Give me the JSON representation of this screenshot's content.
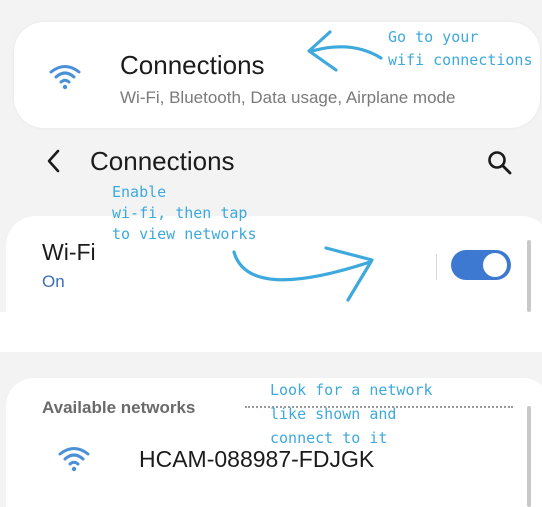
{
  "connections_card": {
    "title": "Connections",
    "subtitle": "Wi-Fi, Bluetooth, Data usage, Airplane mode",
    "icon": "wifi-icon"
  },
  "header": {
    "back_icon": "back-chevron-icon",
    "title": "Connections",
    "search_icon": "search-icon"
  },
  "wifi_row": {
    "label": "Wi-Fi",
    "state": "On",
    "toggle_on": true
  },
  "networks": {
    "section_label": "Available networks",
    "items": [
      {
        "name": "HCAM-088987-FDJGK",
        "icon": "wifi-icon"
      }
    ]
  },
  "annotations": {
    "note_1": [
      "Go to your",
      "wifi connections"
    ],
    "note_2": [
      "Enable",
      "wi-fi, then tap",
      "to view networks"
    ],
    "note_3": [
      "Look for a network",
      "like shown and",
      "connect to it"
    ]
  },
  "colors": {
    "accent": "#3e79d1",
    "wifi_icon": "#4a90d9",
    "annotation": "#3da9dc",
    "panel_bg": "#f3f3f3"
  }
}
